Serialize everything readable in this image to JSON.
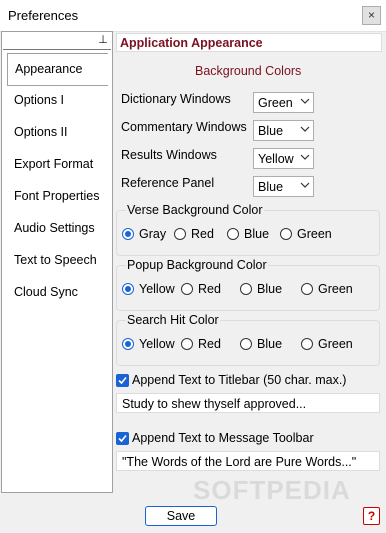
{
  "window": {
    "title": "Preferences",
    "close_glyph": "×"
  },
  "nav": {
    "pin_glyph": "⊥",
    "items": [
      "Appearance",
      "Options I",
      "Options II",
      "Export Format",
      "Font Properties",
      "Audio Settings",
      "Text to Speech",
      "Cloud Sync"
    ],
    "selected": "Appearance"
  },
  "panel": {
    "header": "Application Appearance",
    "background_colors_title": "Background Colors",
    "rows": [
      {
        "label": "Dictionary Windows",
        "value": "Green"
      },
      {
        "label": "Commentary Windows",
        "value": "Blue"
      },
      {
        "label": "Results Windows",
        "value": "Yellow"
      },
      {
        "label": "Reference Panel",
        "value": "Blue"
      }
    ],
    "groups": [
      {
        "legend": "Verse Background Color",
        "options": [
          "Gray",
          "Red",
          "Blue",
          "Green"
        ],
        "selected": "Gray"
      },
      {
        "legend": "Popup Background Color",
        "options": [
          "Yellow",
          "Red",
          "Blue",
          "Green"
        ],
        "selected": "Yellow"
      },
      {
        "legend": "Search Hit Color",
        "options": [
          "Yellow",
          "Red",
          "Blue",
          "Green"
        ],
        "selected": "Yellow"
      }
    ],
    "titlebar_append": {
      "label": "Append Text to Titlebar (50 char. max.)",
      "checked": true,
      "value": "Study to shew thyself approved..."
    },
    "toolbar_append": {
      "label": "Append Text to Message Toolbar",
      "checked": true,
      "value": "\"The Words of the Lord are Pure Words...\""
    }
  },
  "footer": {
    "save_label": "Save",
    "help_label": "?"
  },
  "watermark": "SOFTPEDIA",
  "colors": {
    "accent": "#1a63d6",
    "header_text": "#7b1020",
    "help_red": "#cc0000"
  }
}
